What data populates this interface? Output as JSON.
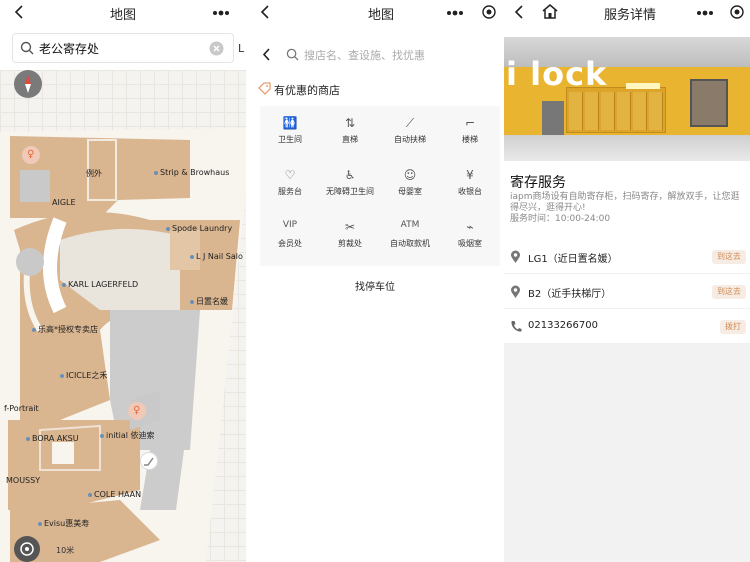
{
  "map_screen": {
    "title": "地图",
    "search_value": "老公寄存处",
    "next_hint": "L",
    "scale_label": "10米",
    "places": [
      "例外",
      "Strip & Browhaus",
      "AIGLE",
      "Spode Laundry",
      "L J Nail Salo",
      "KARL LAGERFELD",
      "日置名媛",
      "乐高*授权专卖店",
      "ICICLE之禾",
      "f-Portrait",
      "BORA AKSU",
      "initial 依迪索",
      "MOUSSY",
      "COLE HAAN",
      "Evisu惠美寿"
    ]
  },
  "search_screen": {
    "title": "地图",
    "search_placeholder": "搜店名、查设施、找优惠",
    "promo_label": "有优惠的商店",
    "facilities": [
      {
        "label": "卫生间",
        "icon": "restroom-icon",
        "glyph": "🚻"
      },
      {
        "label": "直梯",
        "icon": "elevator-icon",
        "glyph": "⇅"
      },
      {
        "label": "自动扶梯",
        "icon": "escalator-icon",
        "glyph": "⟋"
      },
      {
        "label": "楼梯",
        "icon": "stairs-icon",
        "glyph": "⌐"
      },
      {
        "label": "服务台",
        "icon": "heart-icon",
        "glyph": "♡"
      },
      {
        "label": "无障碍卫生间",
        "icon": "wheelchair-icon",
        "glyph": "♿"
      },
      {
        "label": "母婴室",
        "icon": "baby-icon",
        "glyph": "☺"
      },
      {
        "label": "收银台",
        "icon": "yen-icon",
        "glyph": "¥"
      },
      {
        "label": "会员处",
        "icon": "vip-icon",
        "glyph": "VIP"
      },
      {
        "label": "剪裁处",
        "icon": "scissors-icon",
        "glyph": "✂"
      },
      {
        "label": "自动取款机",
        "icon": "atm-icon",
        "glyph": "ATM"
      },
      {
        "label": "吸烟室",
        "icon": "smoking-icon",
        "glyph": "⌁"
      }
    ],
    "parking_label": "找停车位"
  },
  "detail_screen": {
    "title": "服务详情",
    "photo_text": "i lock",
    "service_name": "寄存服务",
    "description": "iapm商场设有自助寄存柜，扫码寄存，解放双手，让您逛得尽兴，逛得开心!",
    "hours": "服务时间：10:00-24:00",
    "locations": [
      {
        "text": "LG1（近日置名媛）",
        "button": "到这去"
      },
      {
        "text": "B2（近手扶梯厅）",
        "button": "到这去"
      }
    ],
    "phone": {
      "text": "02133266700",
      "button": "拨打"
    }
  }
}
